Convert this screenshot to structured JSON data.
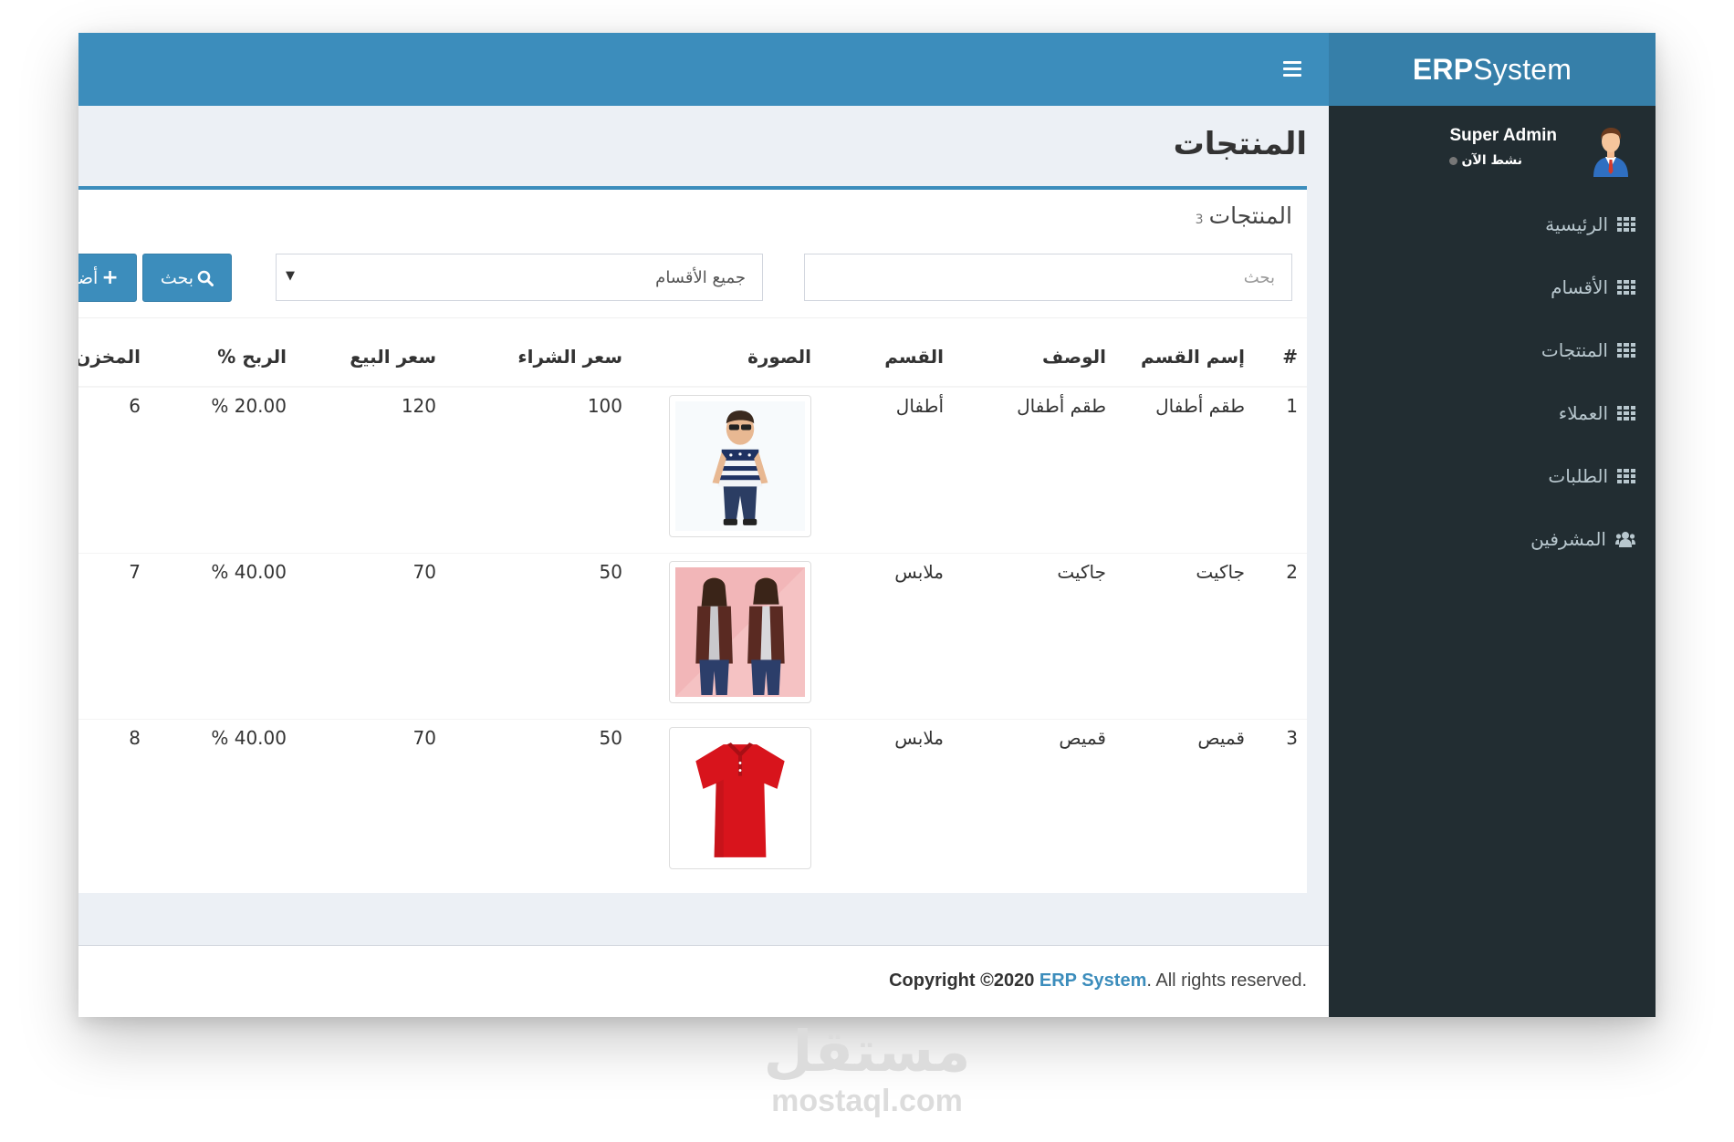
{
  "app": {
    "logo_bold": "ERP",
    "logo_rest": "System"
  },
  "user": {
    "name": "Super Admin",
    "status": "نشط الآن"
  },
  "sidebar": {
    "items": [
      {
        "label": "الرئيسية",
        "icon": "grid-icon"
      },
      {
        "label": "الأقسام",
        "icon": "grid-icon"
      },
      {
        "label": "المنتجات",
        "icon": "grid-icon"
      },
      {
        "label": "العملاء",
        "icon": "grid-icon"
      },
      {
        "label": "الطلبات",
        "icon": "grid-icon"
      },
      {
        "label": "المشرفين",
        "icon": "users-icon"
      }
    ]
  },
  "page": {
    "title": "المنتجات"
  },
  "box": {
    "title": "المنتجات",
    "count": "3"
  },
  "toolbar": {
    "search_placeholder": "بحث",
    "category_select": "جميع الأقسام",
    "search_button": "بحث",
    "add_button": "أضف"
  },
  "table": {
    "headers": [
      "#",
      "إسم القسم",
      "الوصف",
      "القسم",
      "الصورة",
      "سعر الشراء",
      "سعر البيع",
      "الربح %",
      "المخزن"
    ],
    "rows": [
      {
        "num": "1",
        "name": "طقم أطفال",
        "description": "طقم أطفال",
        "category": "أطفال",
        "image": "kids-outfit-image",
        "purchase_price": "100",
        "sale_price": "120",
        "profit": "20.00 %",
        "stock": "6"
      },
      {
        "num": "2",
        "name": "جاكيت",
        "description": "جاكيت",
        "category": "ملابس",
        "image": "jacket-image",
        "purchase_price": "50",
        "sale_price": "70",
        "profit": "40.00 %",
        "stock": "7"
      },
      {
        "num": "3",
        "name": "قميص",
        "description": "قميص",
        "category": "ملابس",
        "image": "shirt-image",
        "purchase_price": "50",
        "sale_price": "70",
        "profit": "40.00 %",
        "stock": "8"
      }
    ]
  },
  "footer": {
    "copyright": "Copyright ©2020",
    "brand": "ERP System",
    "rights": ". All rights reserved."
  },
  "watermark": {
    "arabic": "مستقل",
    "latin": "mostaql.com"
  },
  "colors": {
    "header": "#3c8dbc",
    "logo_bg": "#367fa9",
    "sidebar": "#222d32",
    "content_bg": "#ecf0f5"
  }
}
